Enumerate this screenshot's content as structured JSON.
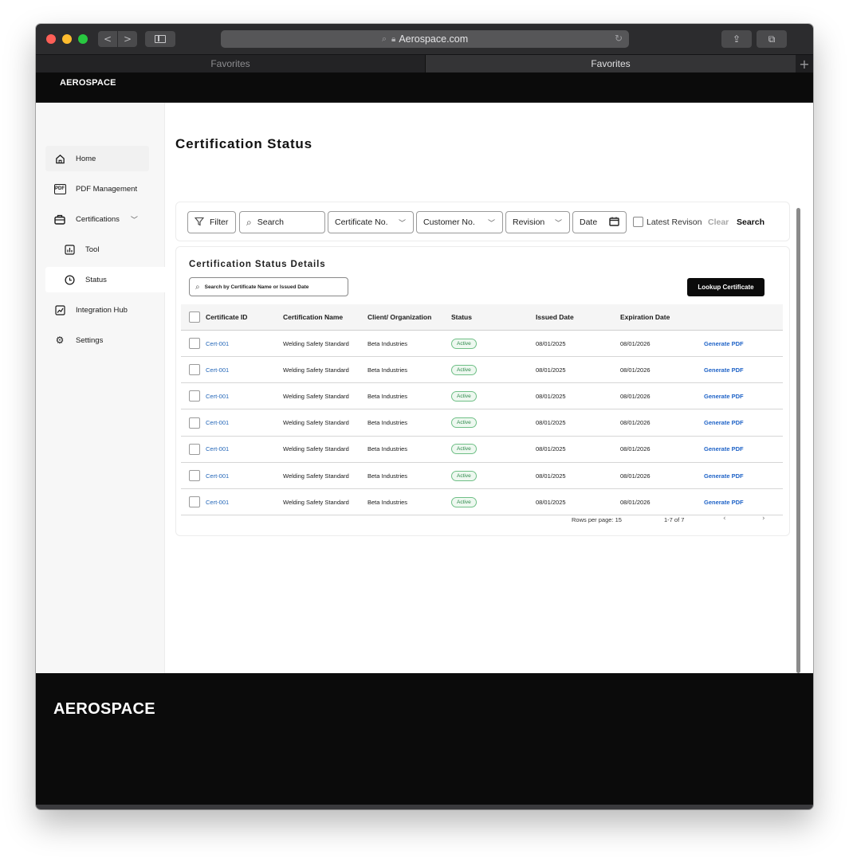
{
  "browser": {
    "url": "Aerospace.com",
    "tabs": [
      {
        "label": "Favorites"
      },
      {
        "label": "Favorites"
      }
    ],
    "new_tab": "+"
  },
  "app": {
    "brand": "AEROSPACE",
    "footer_brand": "AEROSPACE"
  },
  "sidebar": {
    "items": [
      {
        "label": "Home",
        "icon": "home-icon"
      },
      {
        "label": "PDF Management",
        "icon": "pdf-icon"
      },
      {
        "label": "Certifications",
        "icon": "briefcase-icon"
      },
      {
        "label": "Tool",
        "icon": "chart-icon"
      },
      {
        "label": "Status",
        "icon": "clock-icon"
      },
      {
        "label": "Integration Hub",
        "icon": "trend-icon"
      },
      {
        "label": "Settings",
        "icon": "gear-icon"
      }
    ],
    "active": "Status"
  },
  "page": {
    "title": "Certification Status"
  },
  "filters": {
    "filter_label": "Filter",
    "search_placeholder": "Search",
    "certificate_no": "Certificate No.",
    "customer_no": "Customer No.",
    "revision": "Revision",
    "date": "Date",
    "latest_revision": "Latest Revison",
    "clear": "Clear",
    "search": "Search"
  },
  "table": {
    "title": "Certification Status Details",
    "search_placeholder": "Search by Certificate Name or Issued Date",
    "lookup_button": "Lookup Certificate",
    "columns": [
      "Certificate ID",
      "Certification Name",
      "Client/ Organization",
      "Status",
      "Issued Date",
      "Expiration Date"
    ],
    "rows": [
      {
        "id": "Cert-001",
        "name": "Welding Safety Standard",
        "client": "Beta Industries",
        "status": "Active",
        "issued": "08/01/2025",
        "expires": "08/01/2026",
        "action": "Generate PDF"
      },
      {
        "id": "Cert-001",
        "name": "Welding Safety Standard",
        "client": "Beta Industries",
        "status": "Active",
        "issued": "08/01/2025",
        "expires": "08/01/2026",
        "action": "Generate PDF"
      },
      {
        "id": "Cert-001",
        "name": "Welding Safety Standard",
        "client": "Beta Industries",
        "status": "Active",
        "issued": "08/01/2025",
        "expires": "08/01/2026",
        "action": "Generate PDF"
      },
      {
        "id": "Cert-001",
        "name": "Welding Safety Standard",
        "client": "Beta Industries",
        "status": "Active",
        "issued": "08/01/2025",
        "expires": "08/01/2026",
        "action": "Generate PDF"
      },
      {
        "id": "Cert-001",
        "name": "Welding Safety Standard",
        "client": "Beta Industries",
        "status": "Active",
        "issued": "08/01/2025",
        "expires": "08/01/2026",
        "action": "Generate PDF"
      },
      {
        "id": "Cert-001",
        "name": "Welding Safety Standard",
        "client": "Beta Industries",
        "status": "Active",
        "issued": "08/01/2025",
        "expires": "08/01/2026",
        "action": "Generate PDF"
      },
      {
        "id": "Cert-001",
        "name": "Welding Safety Standard",
        "client": "Beta Industries",
        "status": "Active",
        "issued": "08/01/2025",
        "expires": "08/01/2026",
        "action": "Generate PDF"
      }
    ],
    "pagination": {
      "rows_per_page": "Rows per page: 15",
      "range": "1-7 of 7",
      "prev": "‹",
      "next": "›"
    }
  },
  "colors": {
    "brand_dark": "#0b0b0b",
    "link": "#2366b8",
    "status_active": "#2f8a4c"
  }
}
